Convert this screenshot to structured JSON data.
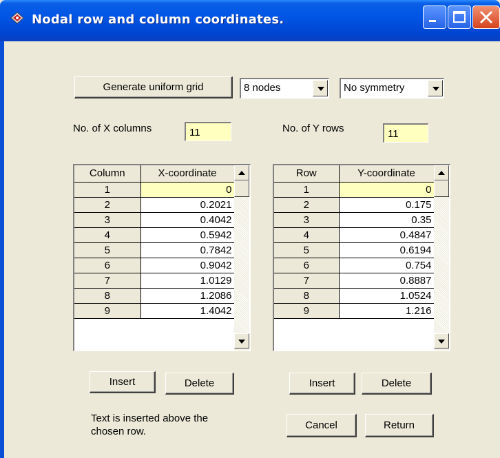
{
  "window": {
    "title": "Nodal row and column coordinates."
  },
  "toolbar": {
    "generate_label": "Generate uniform grid",
    "nodes_value": "8 nodes",
    "symmetry_value": "No symmetry"
  },
  "x_columns": {
    "label": "No. of X columns",
    "value": "11"
  },
  "y_rows": {
    "label": "No. of Y rows",
    "value": "11"
  },
  "x_grid": {
    "headers": [
      "Column",
      "X-coordinate"
    ],
    "rows": [
      {
        "idx": "1",
        "val": "0"
      },
      {
        "idx": "2",
        "val": "0.2021"
      },
      {
        "idx": "3",
        "val": "0.4042"
      },
      {
        "idx": "4",
        "val": "0.5942"
      },
      {
        "idx": "5",
        "val": "0.7842"
      },
      {
        "idx": "6",
        "val": "0.9042"
      },
      {
        "idx": "7",
        "val": "1.0129"
      },
      {
        "idx": "8",
        "val": "1.2086"
      },
      {
        "idx": "9",
        "val": "1.4042"
      }
    ]
  },
  "y_grid": {
    "headers": [
      "Row",
      "Y-coordinate"
    ],
    "rows": [
      {
        "idx": "1",
        "val": "0"
      },
      {
        "idx": "2",
        "val": "0.175"
      },
      {
        "idx": "3",
        "val": "0.35"
      },
      {
        "idx": "4",
        "val": "0.4847"
      },
      {
        "idx": "5",
        "val": "0.6194"
      },
      {
        "idx": "6",
        "val": "0.754"
      },
      {
        "idx": "7",
        "val": "0.8887"
      },
      {
        "idx": "8",
        "val": "1.0524"
      },
      {
        "idx": "9",
        "val": "1.216"
      }
    ]
  },
  "x_actions": {
    "insert_label": "Insert",
    "delete_label": "Delete"
  },
  "y_actions": {
    "insert_label": "Insert",
    "delete_label": "Delete"
  },
  "hint": {
    "line1": "Text is inserted above the",
    "line2": "chosen row."
  },
  "footer": {
    "cancel_label": "Cancel",
    "return_label": "Return"
  }
}
